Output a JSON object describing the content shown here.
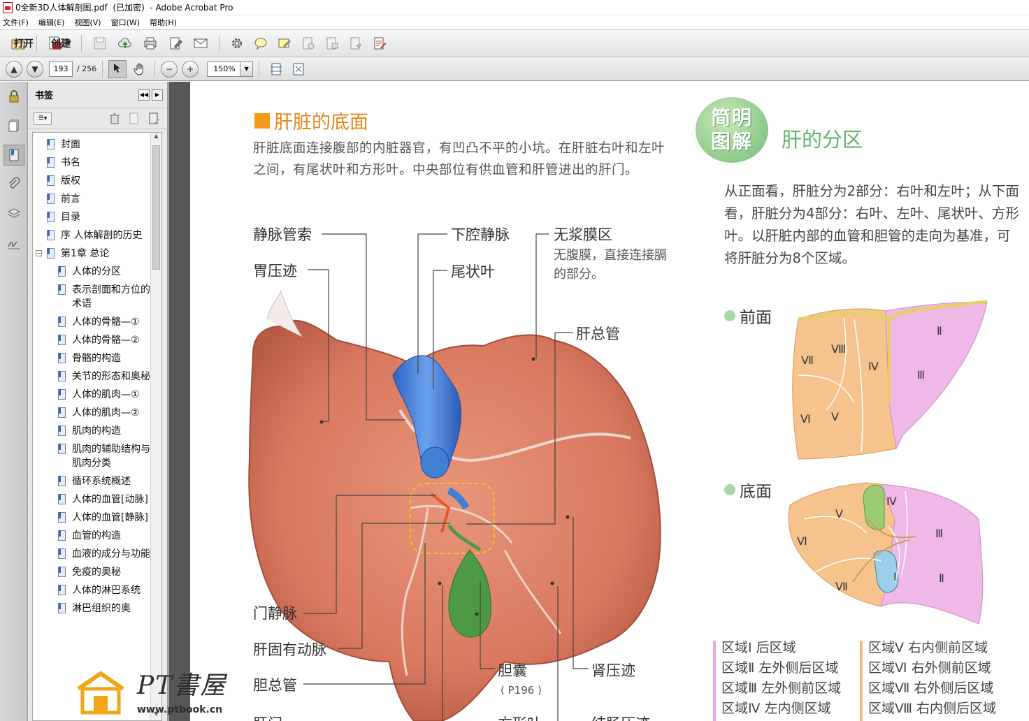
{
  "window": {
    "title": "0全新3D人体解剖图.pdf  (已加密)  - Adobe Acrobat Pro"
  },
  "menu": [
    "文件(F)",
    "编辑(E)",
    "视图(V)",
    "窗口(W)",
    "帮助(H)"
  ],
  "toolbar": {
    "open_label": "打开",
    "create_label": "创建"
  },
  "nav": {
    "page_current": "193",
    "page_total": "/ 256",
    "zoom": "150%"
  },
  "bookmarks": {
    "title": "书签",
    "items": [
      {
        "label": "封面",
        "level": 0
      },
      {
        "label": "书名",
        "level": 0
      },
      {
        "label": "版权",
        "level": 0
      },
      {
        "label": "前言",
        "level": 0
      },
      {
        "label": "目录",
        "level": 0
      },
      {
        "label": "序 人体解剖的历史",
        "level": 0
      },
      {
        "label": "第1章 总论",
        "level": 0,
        "expanded": true
      },
      {
        "label": "人体的分区",
        "level": 1
      },
      {
        "label": "表示剖面和方位的术语",
        "level": 1
      },
      {
        "label": "人体的骨骼—①",
        "level": 1
      },
      {
        "label": "人体的骨骼—②",
        "level": 1
      },
      {
        "label": "骨骼的构造",
        "level": 1
      },
      {
        "label": "关节的形态和奥秘",
        "level": 1
      },
      {
        "label": "人体的肌肉—①",
        "level": 1
      },
      {
        "label": "人体的肌肉—②",
        "level": 1
      },
      {
        "label": "肌肉的构造",
        "level": 1
      },
      {
        "label": "肌肉的辅助结构与肌肉分类",
        "level": 1
      },
      {
        "label": "循环系统概述",
        "level": 1
      },
      {
        "label": "人体的血管[动脉]",
        "level": 1
      },
      {
        "label": "人体的血管[静脉]",
        "level": 1
      },
      {
        "label": "血管的构造",
        "level": 1
      },
      {
        "label": "血液的成分与功能",
        "level": 1
      },
      {
        "label": "免疫的奥秘",
        "level": 1
      },
      {
        "label": "人体的淋巴系统",
        "level": 1
      },
      {
        "label": "淋巴组织的奥",
        "level": 1
      }
    ]
  },
  "page": {
    "section_title": "肝脏的底面",
    "intro": "肝脏底面连接腹部的内脏器官，有凹凸不平的小坑。在肝脏右叶和左叶之间，有尾状叶和方形叶。中央部位有供血管和肝管进出的肝门。",
    "labels": {
      "ligamentum_venosum": "静脉管索",
      "gastric_impression": "胃压迹",
      "ivc": "下腔静脉",
      "caudate": "尾状叶",
      "bare_area": "无浆膜区",
      "bare_area_desc": "无腹膜，直接连接膈的部分。",
      "hepatic_duct": "肝总管",
      "portal_vein": "门静脉",
      "hepatic_artery": "肝固有动脉",
      "bile_duct": "胆总管",
      "gallbladder": "胆囊",
      "gallbladder_ref": "( P196 )",
      "renal_impression": "肾压迹",
      "bottom_cut_1": "肝门",
      "bottom_cut_2": "方形叶",
      "bottom_cut_3": "结肠压迹"
    },
    "badge": [
      "简明",
      "图解"
    ],
    "side_title": "肝的分区",
    "side_text": "从正面看，肝脏分为2部分：右叶和左叶；从下面看，肝脏分为4部分：右叶、左叶、尾状叶、方形叶。以肝脏内部的血管和胆管的走向为基准，可将肝脏分为8个区域。",
    "front_label": "前面",
    "bottom_label": "底面",
    "front_numerals": [
      "Ⅷ",
      "Ⅶ",
      "Ⅳ",
      "Ⅱ",
      "Ⅲ",
      "Ⅵ",
      "Ⅴ"
    ],
    "bottom_numerals": [
      "Ⅳ",
      "Ⅴ",
      "Ⅵ",
      "Ⅲ",
      "Ⅱ",
      "Ⅰ",
      "Ⅶ"
    ],
    "legend_left": [
      "区域Ⅰ  后区域",
      "区域Ⅱ  左外侧后区域",
      "区域Ⅲ  左外侧前区域",
      "区域Ⅳ  左内侧区域"
    ],
    "legend_right": [
      "区域Ⅴ  右内侧前区域",
      "区域Ⅵ  右外侧前区域",
      "区域Ⅶ  右外侧后区域",
      "区域Ⅷ  右内侧后区域"
    ]
  },
  "watermark": {
    "title": "PT書屋",
    "url": "www.ptbook.cn"
  },
  "colors": {
    "section_orange": "#f39a1c",
    "side_green": "#5fb46a",
    "liver": "#d9785f",
    "ivc_blue": "#3f7fd6",
    "gallbladder_green": "#4e9a43",
    "segment_pink": "#f0b8e6",
    "segment_orange": "#f6c38c"
  }
}
